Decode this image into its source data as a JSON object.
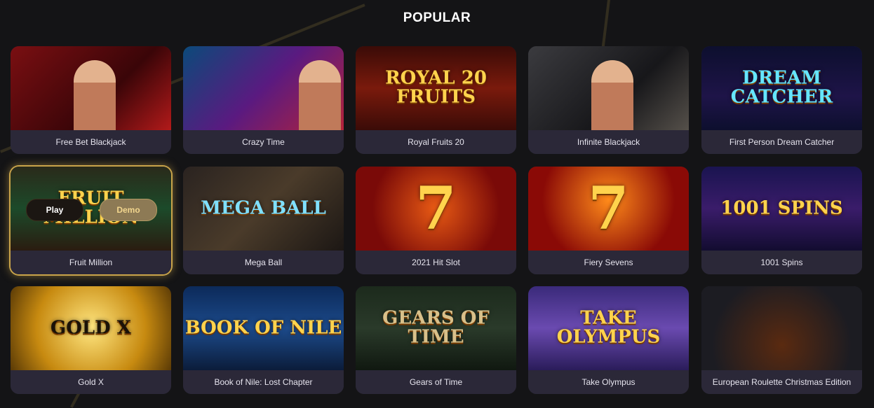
{
  "section": {
    "title": "POPULAR"
  },
  "overlay": {
    "play_label": "Play",
    "demo_label": "Demo"
  },
  "games": [
    {
      "name": "Free Bet Blackjack",
      "art": "",
      "bg": "linear-gradient(135deg,#7a0f12,#3a0508 60%,#b21a1a)",
      "color": "#ffe7a8"
    },
    {
      "name": "Crazy Time",
      "art": "",
      "bg": "linear-gradient(135deg,#0b4a7a,#5a1a80 50%,#b4233a)",
      "color": "#ffd24a"
    },
    {
      "name": "Royal Fruits 20",
      "art": "ROYAL 20 FRUITS",
      "bg": "linear-gradient(180deg,#3a0b07,#7a1a0c 50%,#3a0b07)",
      "color": "#ffd34d"
    },
    {
      "name": "Infinite Blackjack",
      "art": "",
      "bg": "linear-gradient(135deg,#3b3b3f,#17171a 60%,#55504a)",
      "color": "#ffffff"
    },
    {
      "name": "First Person Dream Catcher",
      "art": "DREAM CATCHER",
      "bg": "linear-gradient(180deg,#0d0f2e,#1e1448 60%,#0d0f2e)",
      "color": "#65e6ff"
    },
    {
      "name": "Fruit Million",
      "art": "FRUIT MILLION",
      "bg": "linear-gradient(180deg,#2a2a1a,#1c4a2a 50%,#2a1c10)",
      "color": "#ffd34d"
    },
    {
      "name": "Mega Ball",
      "art": "MEGA BALL",
      "bg": "linear-gradient(135deg,#2a2320,#4a3b2a 50%,#1c1714)",
      "color": "#7fe0ff"
    },
    {
      "name": "2021 Hit Slot",
      "art": "7",
      "bg": "radial-gradient(circle at 50% 50%,#e85a14,#7a0a08 70%)",
      "color": "#ffd34d"
    },
    {
      "name": "Fiery Sevens",
      "art": "7",
      "bg": "radial-gradient(circle at 50% 40%,#ff8a1a,#8a0a06 70%)",
      "color": "#ffd34d"
    },
    {
      "name": "1001 Spins",
      "art": "1001 SPINS",
      "bg": "linear-gradient(180deg,#1a1450,#3a1c6a 50%,#120c30)",
      "color": "#ffd34d"
    },
    {
      "name": "Gold X",
      "art": "GOLD X",
      "bg": "radial-gradient(circle at 50% 50%,#ffe680,#c78a10 60%,#5a3a06)",
      "color": "#1a1208"
    },
    {
      "name": "Book of Nile: Lost Chapter",
      "art": "BOOK OF NILE",
      "bg": "linear-gradient(180deg,#0c2a5a,#1c4a8a 50%,#0b1c3a)",
      "color": "#ffd34d"
    },
    {
      "name": "Gears of Time",
      "art": "GEARS OF TIME",
      "bg": "linear-gradient(180deg,#1c2a1c,#2a3a2a 50%,#101810)",
      "color": "#d8c08a"
    },
    {
      "name": "Take Olympus",
      "art": "TAKE OLYMPUS",
      "bg": "linear-gradient(180deg,#3a2a7a,#6a4ab0 50%,#2a1c5a)",
      "color": "#ffd34d"
    },
    {
      "name": "European Roulette Christmas Edition",
      "art": "",
      "bg": "radial-gradient(circle at 50% 70%,#5a2a10,#1c1c22 70%)",
      "color": "#ffd34d"
    }
  ]
}
